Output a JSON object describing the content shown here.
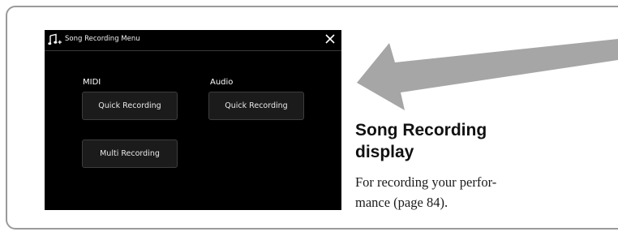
{
  "window": {
    "title": "Song Recording Menu"
  },
  "sections": {
    "midi_label": "MIDI",
    "audio_label": "Audio"
  },
  "buttons": {
    "midi_quick": "Quick Recording",
    "audio_quick": "Quick Recording",
    "midi_multi": "Multi Recording"
  },
  "caption": {
    "title_line1": "Song Recording",
    "title_line2": "display",
    "text_line1": "For recording your perfor-",
    "text_line2": "mance (page 84)."
  },
  "icons": {
    "header": "music-note-plus-icon",
    "close": "close-icon",
    "arrow": "pointer-arrow"
  },
  "colors": {
    "screen_bg": "#000000",
    "button_bg": "#1b1b1b",
    "arrow_fill": "#a6a6a6",
    "frame_border": "#9a9a9a"
  }
}
